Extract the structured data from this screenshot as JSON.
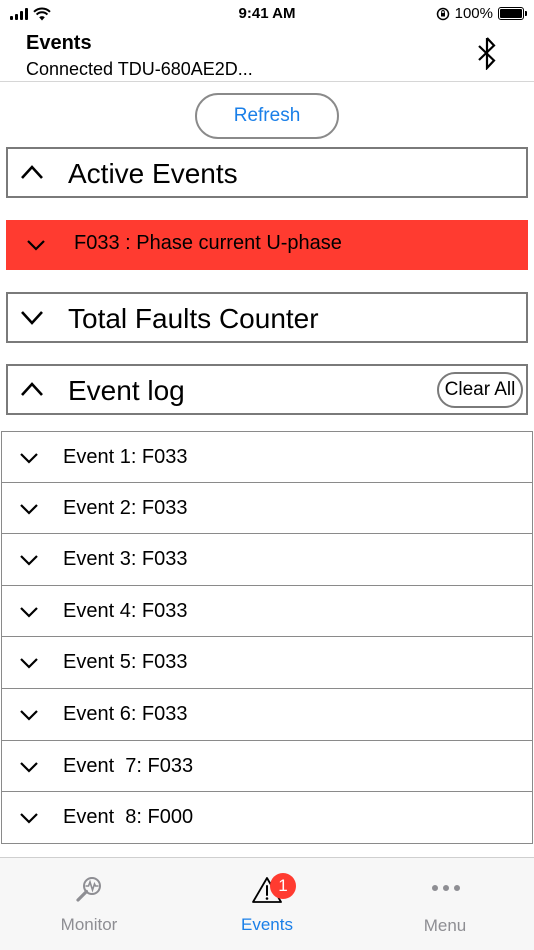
{
  "status_bar": {
    "time": "9:41 AM",
    "battery_text": "100%"
  },
  "header": {
    "title": "Events",
    "subtitle": "Connected TDU-680AE2D..."
  },
  "refresh_label": "Refresh",
  "sections": {
    "active_events": {
      "title": "Active Events",
      "expanded": true
    },
    "active_event_row": {
      "label": "F033 : Phase current U-phase",
      "color": "#ff3b30"
    },
    "total_faults": {
      "title": "Total Faults Counter",
      "expanded": false
    },
    "event_log": {
      "title": "Event log",
      "expanded": true,
      "clear_label": "Clear All"
    }
  },
  "events": [
    {
      "label": "Event 1: F033"
    },
    {
      "label": "Event 2: F033"
    },
    {
      "label": "Event 3: F033"
    },
    {
      "label": "Event 4: F033"
    },
    {
      "label": "Event 5: F033"
    },
    {
      "label": "Event 6: F033"
    },
    {
      "label": "Event  7: F033"
    },
    {
      "label": "Event  8: F000"
    }
  ],
  "tabs": {
    "monitor": {
      "label": "Monitor",
      "icon": "monitor-icon"
    },
    "events": {
      "label": "Events",
      "icon": "warning-icon",
      "badge": "1",
      "active": true
    },
    "menu": {
      "label": "Menu",
      "icon": "more-icon"
    }
  },
  "colors": {
    "accent": "#1a7fe8",
    "alert": "#ff3b30"
  }
}
